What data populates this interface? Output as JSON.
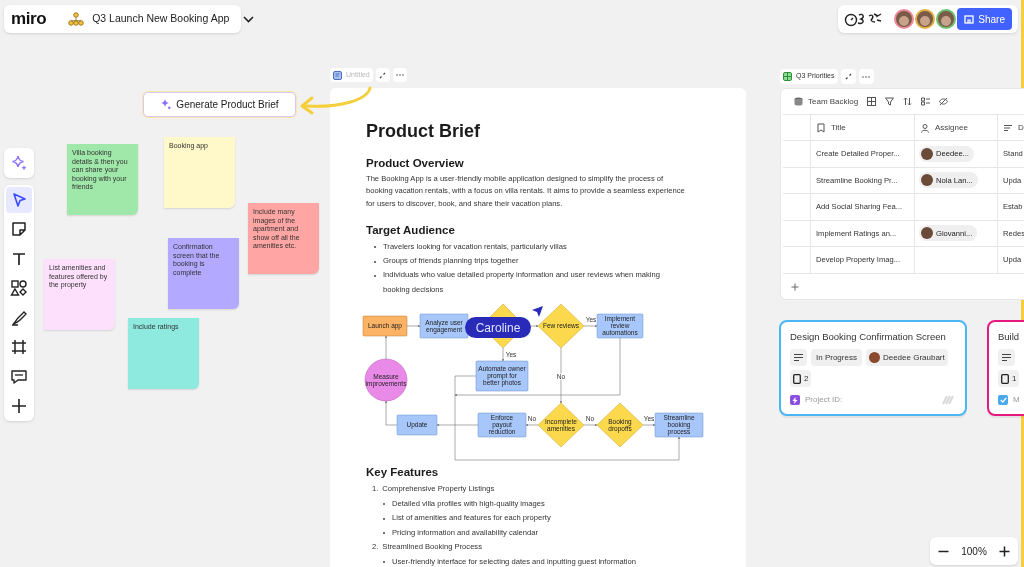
{
  "topbar": {
    "logo": "miro",
    "board_title": "Q3 Launch New Booking App",
    "collaborators": [
      {
        "color": "#ee8a9a"
      },
      {
        "color": "#e0b040"
      },
      {
        "color": "#6cc070"
      }
    ],
    "share": "Share"
  },
  "toolbar": {
    "tools": [
      {
        "kind": "select",
        "selected": true
      },
      {
        "kind": "sticky",
        "selected": false
      },
      {
        "kind": "text",
        "selected": false
      },
      {
        "kind": "shapes",
        "selected": false
      },
      {
        "kind": "pen",
        "selected": false
      },
      {
        "kind": "frame",
        "selected": false
      },
      {
        "kind": "comment",
        "selected": false
      },
      {
        "kind": "add",
        "selected": false
      }
    ]
  },
  "generate_button": "Generate Product Brief",
  "sticky_notes": [
    {
      "text": "Villa booking details & then you can share your booking with your friends",
      "color": "#9fe8aa"
    },
    {
      "text": "Booking app",
      "color": "#fff8c8"
    },
    {
      "text": "Include many images of the apartment and show off all the amenities etc.",
      "color": "#ffa5a3"
    },
    {
      "text": "Confirmation screen that the booking is complete",
      "color": "#b3a9ff"
    },
    {
      "text": "List amenities and features offered by the property",
      "color": "#fde1fc"
    },
    {
      "text": "Include ratings",
      "color": "#8eeadf"
    }
  ],
  "doc": {
    "tab_title": "Untitled",
    "title": "Product Brief",
    "sections": [
      {
        "kind": "heading",
        "text": "Product Overview"
      },
      {
        "kind": "paragraph",
        "text": "The Booking App is a user-friendly mobile application designed to simplify the process of booking vacation rentals, with a focus on villa rentals. It aims to provide a seamless experience for users to discover, book, and share their vacation plans."
      },
      {
        "kind": "heading",
        "text": "Target Audience"
      },
      {
        "kind": "bullets",
        "items": [
          "Travelers looking for vacation rentals, particularly villas",
          "Groups of friends planning trips together",
          "Individuals who value detailed property information and user reviews when making booking decisions"
        ]
      },
      {
        "kind": "flowchart",
        "nodes": [
          {
            "kind": "terminal",
            "label": "Launch app"
          },
          {
            "kind": "process",
            "label": "Analyze user engagement"
          },
          {
            "kind": "decision"
          },
          {
            "kind": "decision",
            "label": "Few reviews"
          },
          {
            "kind": "process",
            "label": "Implement review automations"
          },
          {
            "kind": "circle",
            "label": "Measure improvements"
          },
          {
            "kind": "process",
            "label": "Automate owner prompt for better photos"
          },
          {
            "kind": "process",
            "label": "Update"
          },
          {
            "kind": "process",
            "label": "Enforce payout reduction"
          },
          {
            "kind": "decision",
            "label": "Incomplete amenities"
          },
          {
            "kind": "decision",
            "label": "Booking dropoffs"
          },
          {
            "kind": "process",
            "label": "Streamline booking process"
          }
        ],
        "edge_labels": [
          "Yes",
          "Yes",
          "No",
          "No",
          "No",
          "Yes"
        ],
        "cursor": {
          "name": "Caroline"
        }
      },
      {
        "kind": "heading",
        "text": "Key Features"
      },
      {
        "kind": "numbered",
        "items": [
          {
            "number": "1.",
            "text": "Comprehensive Property Listings",
            "children": [
              "Detailed villa profiles with high-quality images",
              "List of amenities and features for each property",
              "Pricing information and availability calendar"
            ]
          },
          {
            "number": "2.",
            "text": "Streamlined Booking Process",
            "children": [
              "User-friendly interface for selecting dates and inputting guest information"
            ]
          }
        ]
      }
    ]
  },
  "database": {
    "title": "Q3 Priorities",
    "view": "Team Backlog",
    "columns": [
      "Title",
      "Assignee",
      "D"
    ],
    "rows": [
      {
        "title": "Create Detailed Proper...",
        "assignee": "Deedee...",
        "column_3": "Stand"
      },
      {
        "title": "Streamline Booking Pr...",
        "assignee": "Nola Lan...",
        "column_3": "Upda"
      },
      {
        "title": "Add Social Sharing Fea...",
        "column_3": "Estab"
      },
      {
        "title": "Implement Ratings an...",
        "assignee": "Giovanni...",
        "column_3": "Redes"
      },
      {
        "title": "Develop Property Imag...",
        "column_3": "Upda"
      }
    ]
  },
  "cards": [
    {
      "title": "Design Booking Confirmation Screen",
      "color": "#4cb6f5",
      "status": "In Progress",
      "assignee": "Deedee Graubart",
      "count": "2",
      "field": {
        "kind": "project",
        "label": "Project ID:"
      }
    },
    {
      "title": "Build",
      "color": "#e5197f",
      "count": "1",
      "field": {
        "kind": "checkbox",
        "label": "M",
        "checked": true
      }
    }
  ],
  "zoom": "100%"
}
